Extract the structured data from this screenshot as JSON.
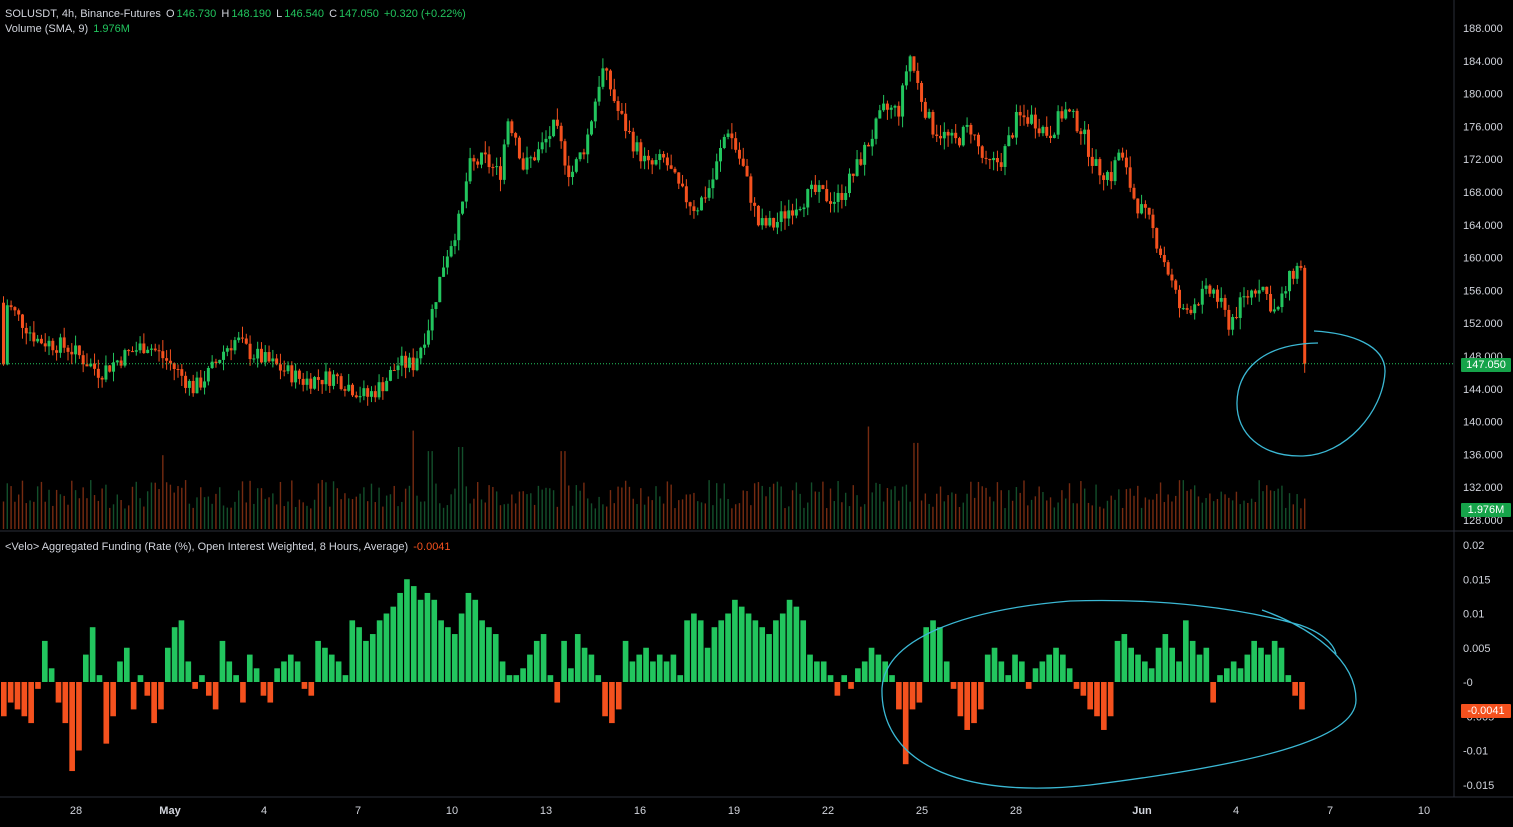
{
  "symbol_header": {
    "symbol": "SOLUSDT, 4h, Binance-Futures",
    "o_label": "O",
    "o_value": "146.730",
    "h_label": "H",
    "h_value": "148.190",
    "l_label": "L",
    "l_value": "146.540",
    "c_label": "C",
    "c_value": "147.050",
    "change": "+0.320 (+0.22%)"
  },
  "volume_header": {
    "label": "Volume (SMA, 9)",
    "value": "1.976M"
  },
  "funding_header": {
    "label": "<Velo> Aggregated Funding (Rate (%), Open Interest Weighted, 8 Hours, Average)",
    "value": "-0.0041"
  },
  "price_tags": {
    "last_price": "147.050",
    "volume": "1.976M",
    "funding": "-0.0041"
  },
  "colors": {
    "up": "#22c55e",
    "down": "#f4511e",
    "annotation": "#3bb8d4",
    "background": "#000000"
  },
  "chart_data": [
    {
      "type": "candlestick",
      "title": "SOLUSDT, 4h, Binance-Futures",
      "y_ticks": [
        "188.000",
        "184.000",
        "180.000",
        "176.000",
        "172.000",
        "168.000",
        "164.000",
        "160.000",
        "156.000",
        "152.000",
        "148.000",
        "144.000",
        "140.000",
        "136.000",
        "132.000",
        "128.000"
      ],
      "ylim": [
        127,
        190
      ],
      "last_close": 147.05,
      "x_ticks": [
        "28",
        "May",
        "4",
        "7",
        "10",
        "13",
        "16",
        "19",
        "22",
        "25",
        "28",
        "Jun",
        "4",
        "7",
        "10"
      ],
      "path_points": [
        {
          "day": 0,
          "price": 154.5
        },
        {
          "day": 2,
          "price": 150
        },
        {
          "day": 4,
          "price": 149
        },
        {
          "day": 6,
          "price": 146
        },
        {
          "day": 7.5,
          "price": 148
        },
        {
          "day": 9,
          "price": 149.5
        },
        {
          "day": 10.5,
          "price": 147
        },
        {
          "day": 12,
          "price": 144
        },
        {
          "day": 13,
          "price": 146
        },
        {
          "day": 14,
          "price": 149
        },
        {
          "day": 14.7,
          "price": 150
        },
        {
          "day": 15.5,
          "price": 148.5
        },
        {
          "day": 17,
          "price": 147
        },
        {
          "day": 19,
          "price": 145
        },
        {
          "day": 21,
          "price": 145.5
        },
        {
          "day": 23,
          "price": 143
        },
        {
          "day": 24,
          "price": 144.5
        },
        {
          "day": 25,
          "price": 147
        },
        {
          "day": 26,
          "price": 147
        },
        {
          "day": 27,
          "price": 152
        },
        {
          "day": 28,
          "price": 160
        },
        {
          "day": 29,
          "price": 165
        },
        {
          "day": 29.5,
          "price": 171
        },
        {
          "day": 30.5,
          "price": 172
        },
        {
          "day": 31.5,
          "price": 170
        },
        {
          "day": 32,
          "price": 177
        },
        {
          "day": 32.5,
          "price": 175
        },
        {
          "day": 33,
          "price": 171
        },
        {
          "day": 34,
          "price": 173
        },
        {
          "day": 35,
          "price": 176
        },
        {
          "day": 36,
          "price": 170
        },
        {
          "day": 37,
          "price": 174
        },
        {
          "day": 38,
          "price": 183
        },
        {
          "day": 38.5,
          "price": 181
        },
        {
          "day": 39,
          "price": 178
        },
        {
          "day": 40,
          "price": 174
        },
        {
          "day": 41,
          "price": 171
        },
        {
          "day": 42,
          "price": 172
        },
        {
          "day": 43,
          "price": 168
        },
        {
          "day": 44,
          "price": 166
        },
        {
          "day": 45,
          "price": 169
        },
        {
          "day": 46,
          "price": 176
        },
        {
          "day": 47,
          "price": 171
        },
        {
          "day": 48,
          "price": 164
        },
        {
          "day": 49,
          "price": 164
        },
        {
          "day": 50,
          "price": 166
        },
        {
          "day": 51.5,
          "price": 168
        },
        {
          "day": 53,
          "price": 167
        },
        {
          "day": 54,
          "price": 170
        },
        {
          "day": 55,
          "price": 174
        },
        {
          "day": 56,
          "price": 178
        },
        {
          "day": 57,
          "price": 178
        },
        {
          "day": 57.6,
          "price": 185
        },
        {
          "day": 58.3,
          "price": 180
        },
        {
          "day": 59,
          "price": 176
        },
        {
          "day": 60.5,
          "price": 174
        },
        {
          "day": 61.5,
          "price": 176
        },
        {
          "day": 62.5,
          "price": 171
        },
        {
          "day": 63.5,
          "price": 172
        },
        {
          "day": 64.5,
          "price": 177
        },
        {
          "day": 65.5,
          "price": 177
        },
        {
          "day": 66.5,
          "price": 175
        },
        {
          "day": 67.5,
          "price": 178
        },
        {
          "day": 68.5,
          "price": 176
        },
        {
          "day": 69.5,
          "price": 171
        },
        {
          "day": 70.5,
          "price": 170
        },
        {
          "day": 71,
          "price": 173
        },
        {
          "day": 72,
          "price": 167
        },
        {
          "day": 73,
          "price": 164
        },
        {
          "day": 74,
          "price": 159
        },
        {
          "day": 75,
          "price": 153
        },
        {
          "day": 76,
          "price": 155
        },
        {
          "day": 77,
          "price": 156
        },
        {
          "day": 78,
          "price": 152
        },
        {
          "day": 79,
          "price": 155
        },
        {
          "day": 80,
          "price": 157
        },
        {
          "day": 81,
          "price": 153
        },
        {
          "day": 82,
          "price": 158
        },
        {
          "day": 83,
          "price": 160
        },
        {
          "day": 83.7,
          "price": 161
        },
        {
          "day": 84.5,
          "price": 155
        },
        {
          "day": 85.5,
          "price": 156
        },
        {
          "day": 86.5,
          "price": 155
        },
        {
          "day": 87.5,
          "price": 152
        },
        {
          "day": 88,
          "price": 151
        },
        {
          "day": 88.5,
          "price": 147
        },
        {
          "day": 89,
          "price": 145
        },
        {
          "day": 89.5,
          "price": 147
        }
      ]
    },
    {
      "type": "bar",
      "title": "Volume (SMA, 9)",
      "last_value": "1.976M",
      "spikes": [
        {
          "day": 10,
          "rel": 0.9,
          "dir": "down"
        },
        {
          "day": 26,
          "rel": 1.2,
          "dir": "up"
        },
        {
          "day": 27,
          "rel": 0.95,
          "dir": "up"
        },
        {
          "day": 29,
          "rel": 1.0,
          "dir": "up"
        },
        {
          "day": 35.5,
          "rel": 0.95,
          "dir": "up"
        },
        {
          "day": 55,
          "rel": 1.25,
          "dir": "down"
        },
        {
          "day": 58,
          "rel": 1.05,
          "dir": "up"
        },
        {
          "day": 88.2,
          "rel": 0.7,
          "dir": "down"
        },
        {
          "day": 88.5,
          "rel": 0.7,
          "dir": "down"
        }
      ]
    },
    {
      "type": "bar",
      "title": "<Velo> Aggregated Funding (Rate (%), Open Interest Weighted, 8 Hours, Average)",
      "y_ticks": [
        "0.02",
        "0.015",
        "0.01",
        "0.005",
        "-0",
        "-0.005",
        "-0.01",
        "-0.015"
      ],
      "ylim": [
        -0.017,
        0.021
      ],
      "last_value": -0.0041,
      "values": [
        -0.005,
        -0.003,
        -0.004,
        -0.005,
        -0.006,
        -0.001,
        0.006,
        0.002,
        -0.003,
        -0.006,
        -0.013,
        -0.01,
        0.004,
        0.008,
        0.001,
        -0.009,
        -0.005,
        0.003,
        0.005,
        -0.004,
        0.001,
        -0.002,
        -0.006,
        -0.004,
        0.005,
        0.008,
        0.009,
        0.003,
        -0.001,
        0.001,
        -0.002,
        -0.004,
        0.006,
        0.003,
        0.001,
        -0.003,
        0.004,
        0.002,
        -0.002,
        -0.003,
        0.002,
        0.003,
        0.004,
        0.003,
        -0.001,
        -0.002,
        0.006,
        0.005,
        0.004,
        0.003,
        0.001,
        0.009,
        0.008,
        0.006,
        0.007,
        0.009,
        0.01,
        0.011,
        0.013,
        0.015,
        0.014,
        0.012,
        0.013,
        0.012,
        0.009,
        0.008,
        0.007,
        0.01,
        0.013,
        0.012,
        0.009,
        0.008,
        0.007,
        0.003,
        0.001,
        0.001,
        0.002,
        0.004,
        0.006,
        0.007,
        0.001,
        -0.003,
        0.006,
        0.002,
        0.007,
        0.005,
        0.004,
        0.001,
        -0.005,
        -0.006,
        -0.004,
        0.006,
        0.003,
        0.004,
        0.005,
        0.003,
        0.004,
        0.003,
        0.004,
        0.001,
        0.009,
        0.01,
        0.009,
        0.005,
        0.008,
        0.009,
        0.01,
        0.012,
        0.011,
        0.01,
        0.009,
        0.008,
        0.007,
        0.009,
        0.01,
        0.012,
        0.011,
        0.009,
        0.004,
        0.003,
        0.003,
        0.001,
        -0.002,
        0.001,
        -0.001,
        0.002,
        0.003,
        0.005,
        0.004,
        0.003,
        0.001,
        -0.004,
        -0.012,
        -0.004,
        -0.003,
        0.008,
        0.009,
        0.008,
        0.003,
        -0.001,
        -0.005,
        -0.007,
        -0.006,
        -0.004,
        0.004,
        0.005,
        0.003,
        0.001,
        0.004,
        0.003,
        -0.001,
        0.002,
        0.003,
        0.004,
        0.005,
        0.004,
        0.002,
        -0.001,
        -0.002,
        -0.004,
        -0.005,
        -0.007,
        -0.005,
        0.006,
        0.007,
        0.005,
        0.004,
        0.003,
        0.002,
        0.005,
        0.007,
        0.005,
        0.003,
        0.009,
        0.006,
        0.004,
        0.005,
        -0.003,
        0.001,
        0.002,
        0.003,
        0.002,
        0.004,
        0.006,
        0.005,
        0.004,
        0.006,
        0.005,
        0.001,
        -0.002,
        -0.004
      ]
    }
  ]
}
